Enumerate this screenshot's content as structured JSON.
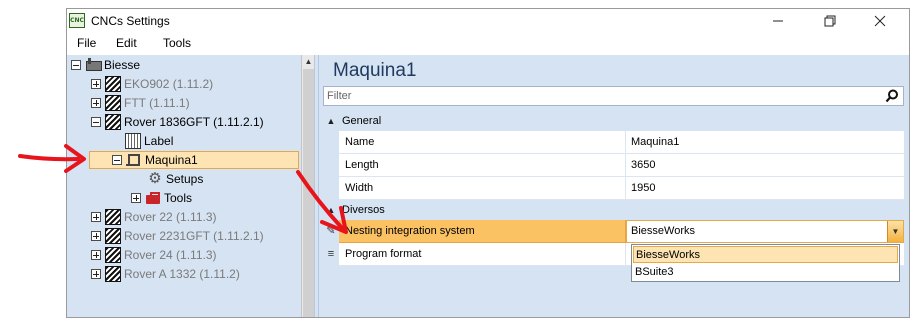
{
  "window": {
    "title": "CNCs Settings",
    "app_icon_text": "CNC"
  },
  "menu": [
    "File",
    "Edit",
    "Tools"
  ],
  "tree": {
    "root": "Biesse",
    "machines": [
      {
        "label": "EKO902 (1.11.2)"
      },
      {
        "label": "FTT (1.11.1)"
      },
      {
        "label": "Rover 1836GFT (1.11.2.1)"
      },
      {
        "label": "Rover 22 (1.11.3)"
      },
      {
        "label": "Rover 2231GFT (1.11.2.1)"
      },
      {
        "label": "Rover 24 (1.11.3)"
      },
      {
        "label": "Rover A 1332 (1.11.2)"
      }
    ],
    "rover1836_children": {
      "label": "Label",
      "maquina": "Maquina1",
      "setups": "Setups",
      "tools": "Tools"
    }
  },
  "details": {
    "title": "Maquina1",
    "filter_placeholder": "Filter",
    "categories": {
      "general": "General",
      "diversos": "Diversos"
    },
    "general_props": [
      {
        "name": "Name",
        "value": "Maquina1"
      },
      {
        "name": "Length",
        "value": "3650"
      },
      {
        "name": "Width",
        "value": "1950"
      }
    ],
    "diversos_props": [
      {
        "name": "Nesting integration system",
        "value": "BiesseWorks"
      },
      {
        "name": "Program format",
        "value": ""
      }
    ],
    "dropdown_options": [
      "BiesseWorks",
      "BSuite3"
    ]
  },
  "colors": {
    "panel_bg": "#d6e3f2",
    "selection": "#fde4b2",
    "active_property": "#fbc264",
    "annotation_arrow": "#e8141c"
  }
}
